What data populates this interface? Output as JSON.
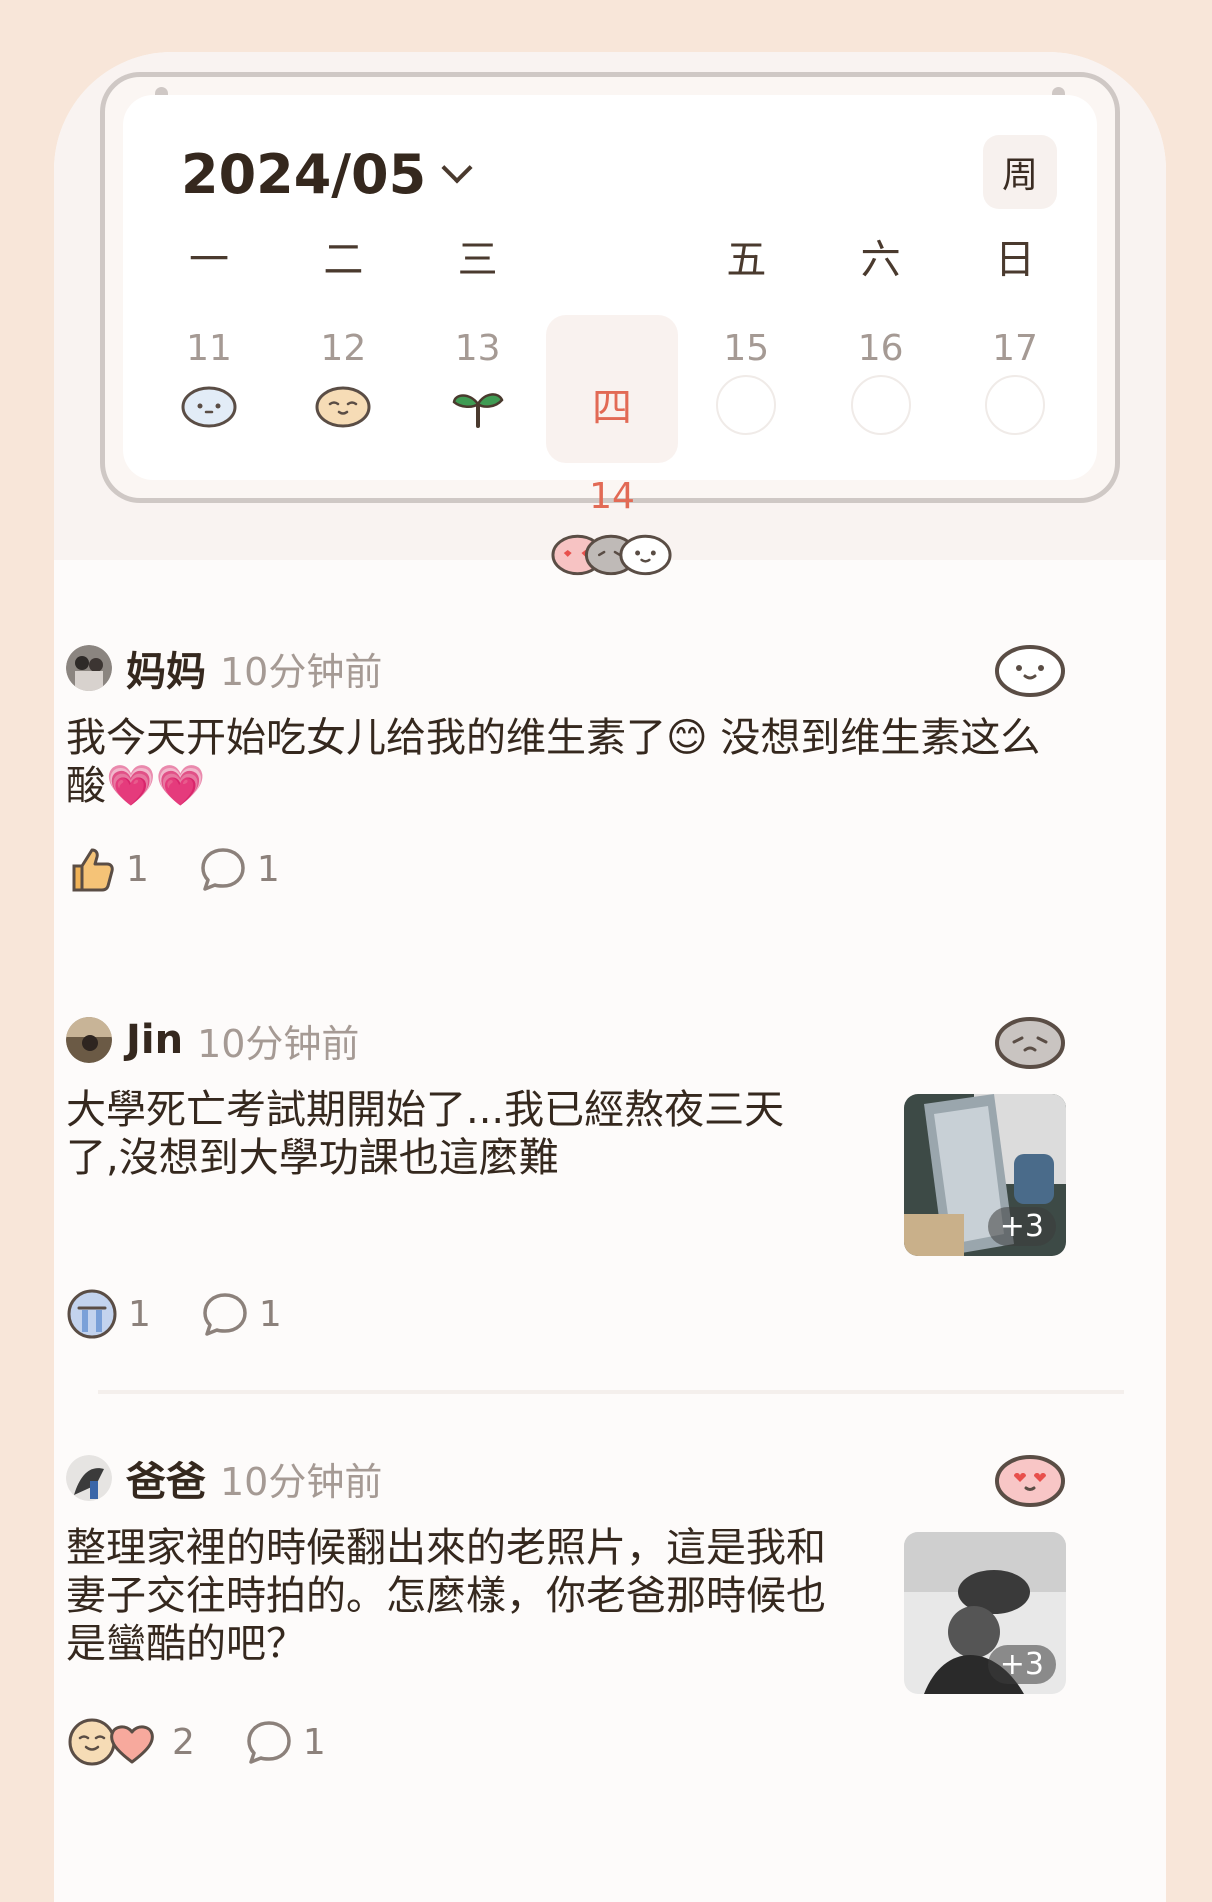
{
  "calendar": {
    "month": "2024/05",
    "week_button": "周",
    "days": [
      {
        "weekday": "一",
        "date": "11",
        "mood": "calm",
        "today": false
      },
      {
        "weekday": "二",
        "date": "12",
        "mood": "content",
        "today": false
      },
      {
        "weekday": "三",
        "date": "13",
        "mood": "sprout",
        "today": false
      },
      {
        "weekday": "四",
        "date": "14",
        "mood": "multi",
        "today": true
      },
      {
        "weekday": "五",
        "date": "15",
        "mood": "none",
        "today": false
      },
      {
        "weekday": "六",
        "date": "16",
        "mood": "none",
        "today": false
      },
      {
        "weekday": "日",
        "date": "17",
        "mood": "none",
        "today": false
      }
    ]
  },
  "posts": [
    {
      "user": "妈妈",
      "time": "10分钟前",
      "text": "我今天开始吃女儿给我的维生素了😊 没想到维生素这么酸💗💗",
      "mood": "smile-outline",
      "likes": "1",
      "comments": "1"
    },
    {
      "user": "Jin",
      "time": "10分钟前",
      "text": "大學死亡考試期開始了...我已經熬夜三天了,沒想到大學功課也這麼難",
      "mood": "sad-gray",
      "image_more": "+3",
      "likes": "1",
      "comments": "1"
    },
    {
      "user": "爸爸",
      "time": "10分钟前",
      "text": "整理家裡的時候翻出來的老照片，這是我和妻子交往時拍的。怎麼樣，你老爸那時候也是蠻酷的吧？",
      "mood": "love-pink",
      "image_more": "+3",
      "likes": "2",
      "comments": "1"
    }
  ],
  "colors": {
    "accent": "#e26a55",
    "frame": "#f8e6d9",
    "text": "#35281e",
    "muted": "#a59a94"
  }
}
